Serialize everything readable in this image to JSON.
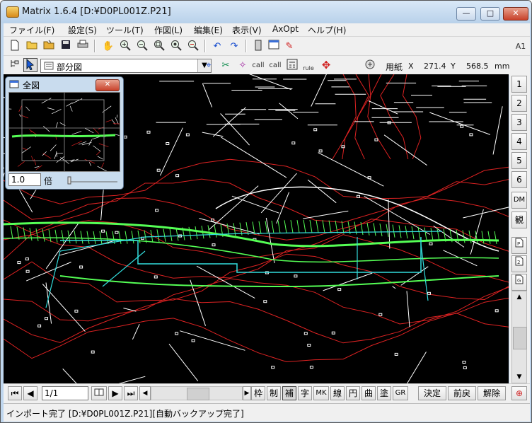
{
  "window": {
    "title": "Matrix 1.6.4  [D:¥D0PL001Z.P21]",
    "controls": {
      "minimize": "—",
      "maximize": "□",
      "close": "✕"
    }
  },
  "menu": [
    "ファイル(F)",
    "設定(S)",
    "ツール(T)",
    "作図(L)",
    "編集(E)",
    "表示(V)",
    "AxOpt",
    "ヘルプ(H)"
  ],
  "toolbar": {
    "call1": "call",
    "call2": "call",
    "rule": "rule",
    "paper_label": "用紙",
    "coord_x_label": "X",
    "coord_x_value": "271.4",
    "coord_y_label": "Y",
    "coord_y_value": "568.5",
    "coord_unit": "mm",
    "a1": "A1"
  },
  "view_combo": {
    "value": "部分図"
  },
  "right_buttons": [
    "1",
    "2",
    "3",
    "4",
    "5",
    "6",
    "DM",
    "観"
  ],
  "bottom": {
    "page": "1/1",
    "tools": [
      "枠",
      "制",
      "補",
      "字",
      "MK",
      "線",
      "円",
      "曲",
      "塗",
      "GR"
    ],
    "confirm": "決定",
    "undo": "前戻",
    "cancel": "解除"
  },
  "status": "インポート完了 [D:¥D0PL001Z.P21][自動バックアップ完了]",
  "overview": {
    "title": "全図",
    "zoom": "1.0",
    "unit": "倍"
  },
  "colors": {
    "canvas_bg": "#000000",
    "road": "#55ff55",
    "contour": "#dd2222",
    "cyan": "#33dddd",
    "line": "#ffffff"
  }
}
